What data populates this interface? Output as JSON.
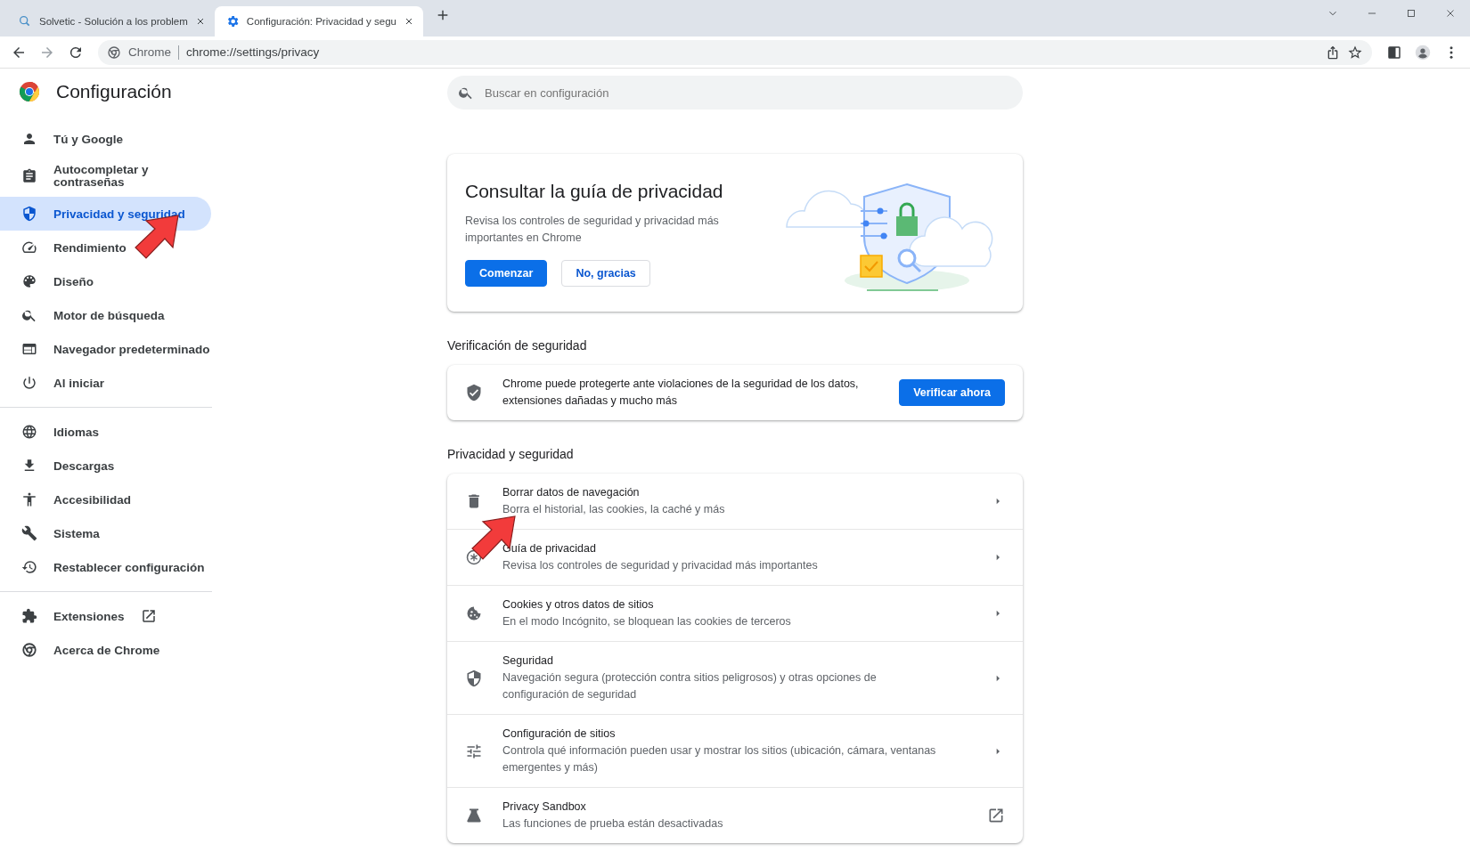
{
  "browser": {
    "tabs": [
      {
        "title": "Solvetic - Solución a los problem",
        "selected": false
      },
      {
        "title": "Configuración: Privacidad y segu",
        "selected": true
      }
    ],
    "address": {
      "site": "Chrome",
      "url": "chrome://settings/privacy"
    }
  },
  "settings": {
    "title": "Configuración",
    "search": {
      "placeholder": "Buscar en configuración"
    },
    "sidebar": {
      "groups": [
        [
          {
            "label": "Tú y Google",
            "kind": "page",
            "selected": false
          },
          {
            "label": "Autocompletar y contraseñas",
            "kind": "page",
            "selected": false
          },
          {
            "label": "Privacidad y seguridad",
            "kind": "page",
            "selected": true
          },
          {
            "label": "Rendimiento",
            "kind": "page",
            "selected": false
          },
          {
            "label": "Diseño",
            "kind": "page",
            "selected": false
          },
          {
            "label": "Motor de búsqueda",
            "kind": "page",
            "selected": false
          },
          {
            "label": "Navegador predeterminado",
            "kind": "page",
            "selected": false
          },
          {
            "label": "Al iniciar",
            "kind": "page",
            "selected": false
          }
        ],
        [
          {
            "label": "Idiomas",
            "kind": "page",
            "selected": false
          },
          {
            "label": "Descargas",
            "kind": "page",
            "selected": false
          },
          {
            "label": "Accesibilidad",
            "kind": "page",
            "selected": false
          },
          {
            "label": "Sistema",
            "kind": "page",
            "selected": false
          },
          {
            "label": "Restablecer configuración",
            "kind": "page",
            "selected": false
          }
        ],
        [
          {
            "label": "Extensiones",
            "kind": "external",
            "selected": false
          },
          {
            "label": "Acerca de Chrome",
            "kind": "page",
            "selected": false
          }
        ]
      ]
    },
    "promo": {
      "title": "Consultar la guía de privacidad",
      "description": "Revisa los controles de seguridad y privacidad más importantes en Chrome",
      "buttons": [
        {
          "label": "Comenzar",
          "kind": "primary"
        },
        {
          "label": "No, gracias",
          "kind": "secondary"
        }
      ]
    },
    "safety_check": {
      "heading": "Verificación de seguridad",
      "text": "Chrome puede protegerte ante violaciones de la seguridad de los datos, extensiones dañadas y mucho más",
      "button": "Verificar ahora"
    },
    "privacy": {
      "heading": "Privacidad y seguridad",
      "rows": [
        {
          "title": "Borrar datos de navegación",
          "subtitle": "Borra el historial, las cookies, la caché y más",
          "kind": "submenu"
        },
        {
          "title": "Guía de privacidad",
          "subtitle": "Revisa los controles de seguridad y privacidad más importantes",
          "kind": "submenu"
        },
        {
          "title": "Cookies y otros datos de sitios",
          "subtitle": "En el modo Incógnito, se bloquean las cookies de terceros",
          "kind": "submenu"
        },
        {
          "title": "Seguridad",
          "subtitle": "Navegación segura (protección contra sitios peligrosos) y otras opciones de configuración de seguridad",
          "kind": "submenu"
        },
        {
          "title": "Configuración de sitios",
          "subtitle": "Controla qué información pueden usar y mostrar los sitios (ubicación, cámara, ventanas emergentes y más)",
          "kind": "submenu"
        },
        {
          "title": "Privacy Sandbox",
          "subtitle": "Las funciones de prueba están desactivadas",
          "kind": "external"
        }
      ]
    }
  }
}
